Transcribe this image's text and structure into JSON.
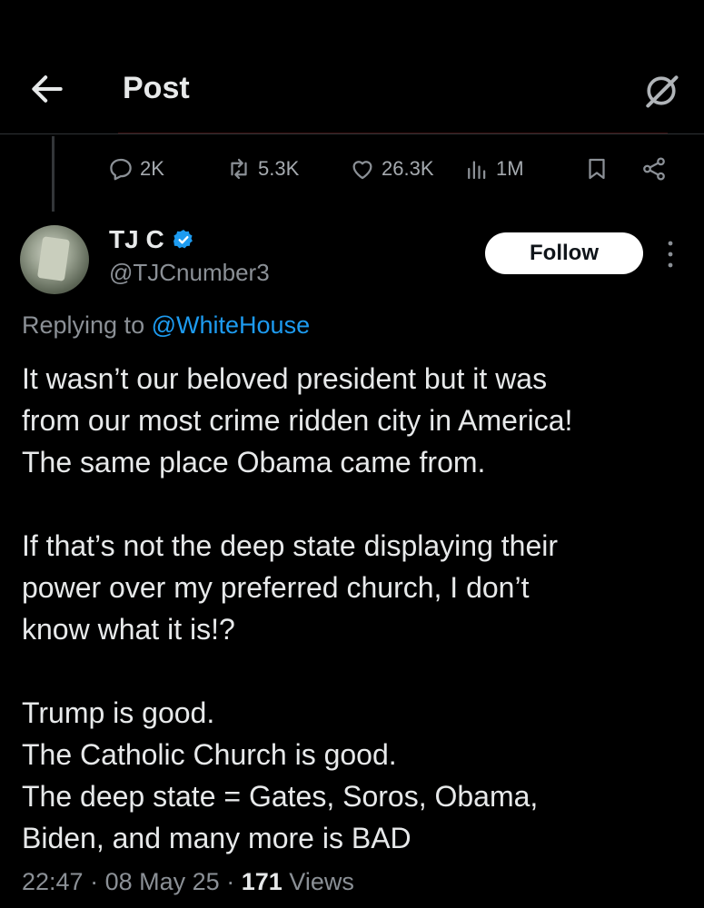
{
  "header": {
    "title": "Post"
  },
  "engagement": {
    "replies": "2K",
    "reposts": "5.3K",
    "likes": "26.3K",
    "views": "1M"
  },
  "author": {
    "name": "TJ C",
    "handle": "@TJCnumber3",
    "follow_label": "Follow"
  },
  "reply": {
    "prefix": "Replying to",
    "mention": "@WhiteHouse"
  },
  "post": {
    "lines": [
      "It wasn’t our beloved president but it was",
      "from our most crime ridden city in America!",
      "The same place Obama came from.",
      "",
      "If that’s not the deep state displaying their",
      "power over my preferred church, I don’t",
      "know what it is!?",
      "",
      "Trump is good.",
      "The Catholic Church is good.",
      "The deep state = Gates, Soros, Obama,",
      "Biden, and many more is BAD"
    ]
  },
  "meta": {
    "time": "22:47",
    "date": "08 May 25",
    "view_count": "171",
    "views_label": "Views"
  },
  "colors": {
    "background": "#000000",
    "text": "#e7e9ea",
    "secondary": "#8b9096",
    "accent": "#1d9bf0"
  }
}
